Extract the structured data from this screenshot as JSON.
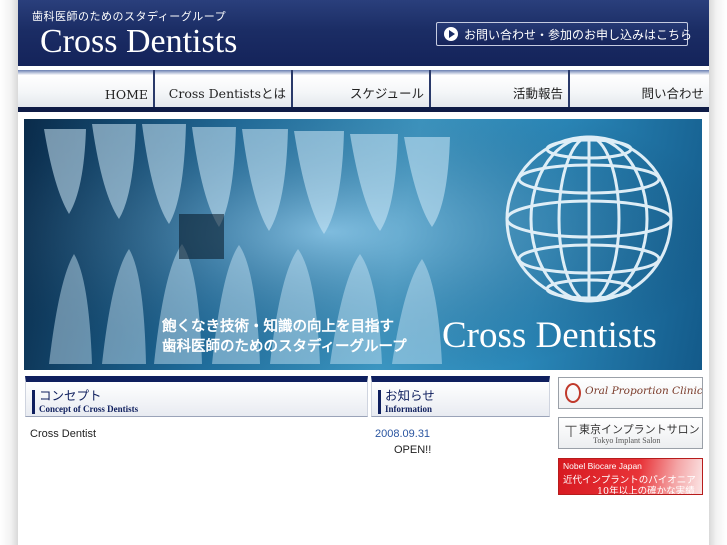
{
  "header": {
    "subtitle": "歯科医師のためのスタディーグループ",
    "title": "Cross Dentists",
    "contact_button": "お問い合わせ・参加のお申し込みはこちら"
  },
  "nav": {
    "items": [
      {
        "label": "HOME"
      },
      {
        "label": "Cross Dentistsとは"
      },
      {
        "label": "スケジュール"
      },
      {
        "label": "活動報告"
      },
      {
        "label": "問い合わせ"
      }
    ]
  },
  "hero": {
    "caption_line1": "飽くなき技術・知識の向上を目指す",
    "caption_line2": "歯科医師のためのスタディーグループ",
    "title": "Cross Dentists"
  },
  "concept": {
    "heading_jp": "コンセプト",
    "heading_en": "Concept of Cross Dentists",
    "text": "Cross Dentist"
  },
  "information": {
    "heading_jp": "お知らせ",
    "heading_en": "Information",
    "news": [
      {
        "date": "2008.09.31",
        "text": "OPEN!!"
      }
    ]
  },
  "banners": {
    "oral": {
      "text": "Oral Proportion Clinic"
    },
    "tokyo": {
      "jp": "東京インプラントサロン",
      "en": "Tokyo Implant Salon"
    },
    "nobel": {
      "top": "Nobel Biocare Japan",
      "line1": "近代インプラントのパイオニア",
      "line2": "10年以上の確かな実績"
    }
  },
  "colors": {
    "header_navy": "#1b2d65",
    "section_navy": "#0f1f5e",
    "news_date_blue": "#2a55a0",
    "nobel_red": "#d71920"
  }
}
